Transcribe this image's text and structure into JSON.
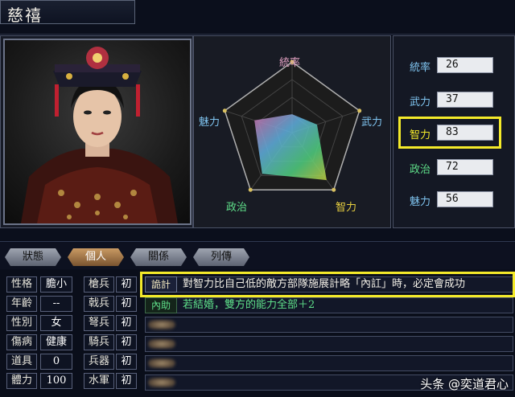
{
  "character": {
    "name": "慈禧"
  },
  "radar": {
    "labels": {
      "top": "統率",
      "right": "武力",
      "bottom_right": "智力",
      "bottom_left": "政治",
      "left": "魅力"
    },
    "values": {
      "tongshuai": 26,
      "wuli": 37,
      "zhili": 83,
      "zhengzhi": 72,
      "meili": 56
    },
    "max": 100
  },
  "stats": [
    {
      "label": "統率",
      "value": "26",
      "color": "#7fc4f0"
    },
    {
      "label": "武力",
      "value": "37",
      "color": "#7fc4f0"
    },
    {
      "label": "智力",
      "value": "83",
      "color": "#f4ea2a"
    },
    {
      "label": "政治",
      "value": "72",
      "color": "#5fe08a"
    },
    {
      "label": "魅力",
      "value": "56",
      "color": "#7fc4f0"
    }
  ],
  "tabs": [
    {
      "label": "狀態",
      "active": false
    },
    {
      "label": "個人",
      "active": true
    },
    {
      "label": "關係",
      "active": false
    },
    {
      "label": "列傳",
      "active": false
    }
  ],
  "personal": {
    "rows": [
      {
        "l1": "性格",
        "v1": "膽小",
        "l2": "槍兵",
        "v2": "初"
      },
      {
        "l1": "年齡",
        "v1": "--",
        "l2": "戟兵",
        "v2": "初"
      },
      {
        "l1": "性別",
        "v1": "女",
        "l2": "弩兵",
        "v2": "初"
      },
      {
        "l1": "傷病",
        "v1": "健康",
        "l2": "騎兵",
        "v2": "初"
      },
      {
        "l1": "道具",
        "v1": "0",
        "l2": "兵器",
        "v2": "初"
      },
      {
        "l1": "體力",
        "v1": "100",
        "l2": "水軍",
        "v2": "初"
      }
    ]
  },
  "skills": [
    {
      "tag": "詭計",
      "text": "對智力比自己低的敵方部隊施展計略「內訌」時，必定會成功",
      "tag_color": "#f2e8c0"
    },
    {
      "tag": "內助",
      "text": "若結婚，雙方的能力全部＋2",
      "tag_color": "#5fe08a"
    }
  ],
  "watermark": "头条 @奕道君心",
  "colors": {
    "highlight": "#f4ea2a"
  }
}
